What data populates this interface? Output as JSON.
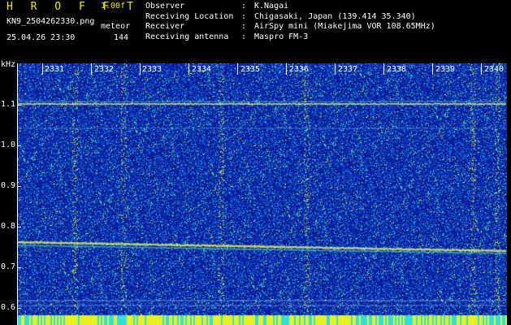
{
  "header": {
    "app_title": "H R O F F T",
    "version": "1.00f",
    "file_name": "KN9_2504262330.png",
    "mode": "meteor",
    "timestamp": "25.04.26 23:30",
    "count": "144"
  },
  "station_info": [
    {
      "label": "Observer",
      "value": "K.Nagai"
    },
    {
      "label": "Receiving Location",
      "value": "Chigasaki, Japan (139.414 35.340)"
    },
    {
      "label": "Receiver",
      "value": "AirSpy mini (Miakejima VOR 108.65MHz)"
    },
    {
      "label": "Receiving antenna",
      "value": "Maspro FM-3"
    }
  ],
  "info_separator": ":",
  "y_axis": {
    "unit": "kHz",
    "ticks": [
      "1.1",
      "1.0",
      "0.9",
      "0.8",
      "0.7",
      "0.6"
    ]
  },
  "x_axis": {
    "ticks": [
      "2331",
      "2332",
      "2333",
      "2334",
      "2335",
      "2336",
      "2337",
      "2338",
      "2339",
      "2340"
    ]
  },
  "colors": {
    "background": "#000000",
    "plot_base": "#0a1a9a",
    "title_yellow": "#f0f000"
  }
}
